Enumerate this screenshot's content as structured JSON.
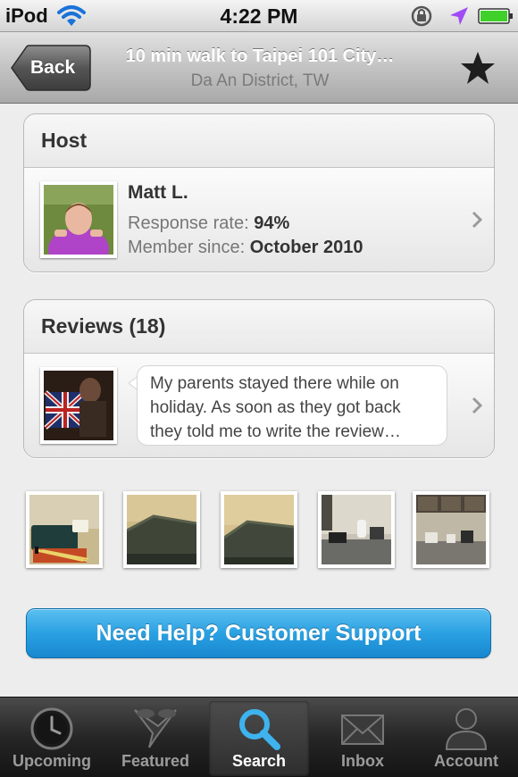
{
  "status_bar": {
    "carrier": "iPod",
    "time": "4:22 PM",
    "battery_color": "#3fd12a"
  },
  "nav": {
    "back_label": "Back",
    "title": "10 min walk to Taipei 101 City…",
    "subtitle": "Da An District, TW"
  },
  "host": {
    "header": "Host",
    "name": "Matt L.",
    "response_rate_label": "Response rate:",
    "response_rate_value": "94%",
    "member_since_label": "Member since:",
    "member_since_value": "October 2010"
  },
  "reviews": {
    "header": "Reviews (18)",
    "excerpt_line1": "My parents stayed there while on",
    "excerpt_line2": "holiday. As soon as they got back",
    "excerpt_line3": "they told me to write the review…"
  },
  "photos": [
    {
      "icon": "living-room-photo"
    },
    {
      "icon": "bedroom-photo"
    },
    {
      "icon": "bedroom-photo-2"
    },
    {
      "icon": "kitchen-photo"
    },
    {
      "icon": "kitchen-photo-2"
    }
  ],
  "help_button": {
    "label": "Need Help? Customer Support"
  },
  "tabs": [
    {
      "label": "Upcoming",
      "icon": "clock-icon",
      "selected": false
    },
    {
      "label": "Featured",
      "icon": "featured-icon",
      "selected": false
    },
    {
      "label": "Search",
      "icon": "search-icon",
      "selected": true
    },
    {
      "label": "Inbox",
      "icon": "envelope-icon",
      "selected": false
    },
    {
      "label": "Account",
      "icon": "person-icon",
      "selected": false
    }
  ],
  "colors": {
    "accent_blue": "#2aa1e3",
    "location_arrow": "#a04cf5"
  }
}
